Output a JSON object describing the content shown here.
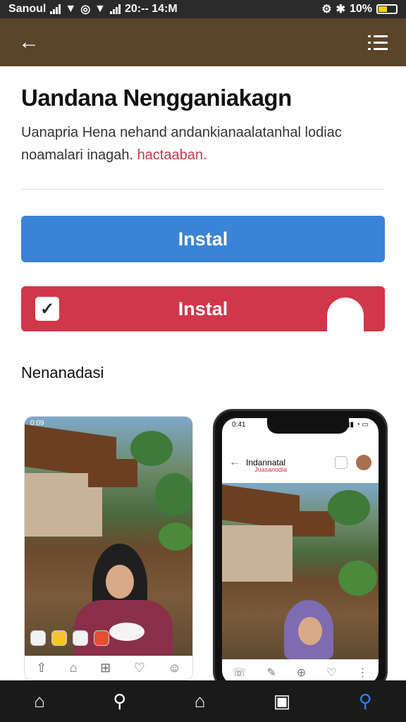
{
  "status_bar": {
    "carrier": "Sanoul",
    "time": "20:-- 14:M",
    "battery": "10%"
  },
  "content": {
    "title": "Uandana Nengganiakagn",
    "description": "Uanapria Hena nehand andankianaalatanhal lodiac noamalari inagah.",
    "description_accent": "hactaaban.",
    "primary_button": "Instal",
    "secondary_button": "Instal",
    "section_title": "Nenanadasi"
  },
  "screenshot_left": {
    "time": "0:09"
  },
  "phone_preview": {
    "time": "0:41",
    "app_title": "Indannatal",
    "subtitle": "Juasanodia"
  },
  "icons": {
    "back": "arrow-left-icon",
    "menu": "list-menu-icon",
    "check": "checkbox-icon",
    "hand": "hand-cursor-icon"
  },
  "colors": {
    "app_bar": "#5b4528",
    "primary": "#3b83d6",
    "secondary": "#d2364a",
    "accent_text": "#c43848",
    "nav_active": "#2f7fe8"
  }
}
